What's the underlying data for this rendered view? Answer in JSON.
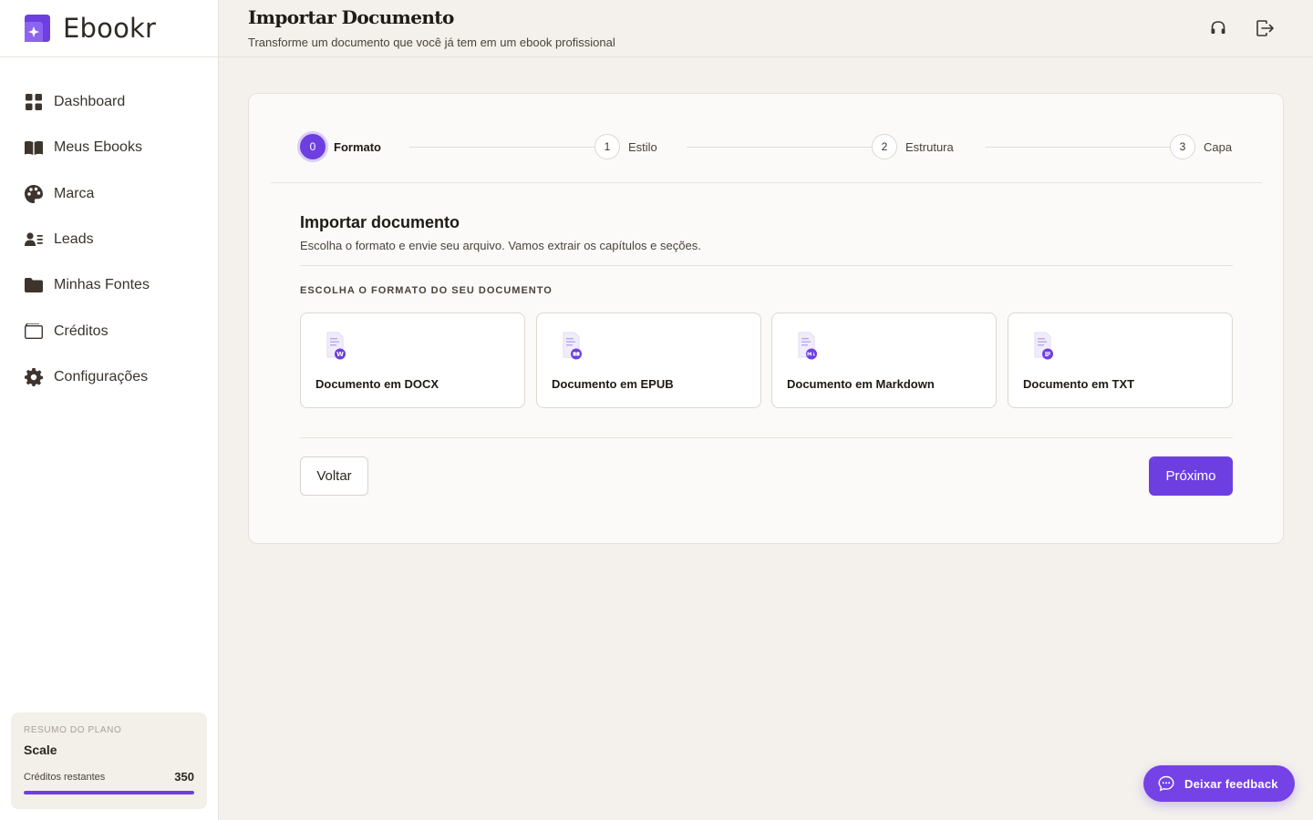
{
  "brand": {
    "name": "Ebookr",
    "accent": "#6d3fe0"
  },
  "sidebar": {
    "items": [
      {
        "label": "Dashboard",
        "icon": "dashboard-icon"
      },
      {
        "label": "Meus Ebooks",
        "icon": "book-icon"
      },
      {
        "label": "Marca",
        "icon": "palette-icon"
      },
      {
        "label": "Leads",
        "icon": "contacts-icon"
      },
      {
        "label": "Minhas Fontes",
        "icon": "folder-icon"
      },
      {
        "label": "Créditos",
        "icon": "wallet-icon"
      },
      {
        "label": "Configurações",
        "icon": "gear-icon"
      }
    ],
    "plan": {
      "caption": "RESUMO DO PLANO",
      "name": "Scale",
      "credits_label": "Créditos restantes",
      "credits_value": "350",
      "credits_fraction": 1.0
    }
  },
  "header": {
    "title": "Importar Documento",
    "subtitle": "Transforme um documento que você já tem em um ebook profissional",
    "support_icon": "headset-icon",
    "logout_icon": "logout-icon"
  },
  "stepper": {
    "steps": [
      {
        "number": "0",
        "label": "Formato",
        "active": true
      },
      {
        "number": "1",
        "label": "Estilo",
        "active": false
      },
      {
        "number": "2",
        "label": "Estrutura",
        "active": false
      },
      {
        "number": "3",
        "label": "Capa",
        "active": false
      }
    ]
  },
  "main": {
    "title": "Importar documento",
    "description": "Escolha o formato e envie seu arquivo. Vamos extrair os capítulos e seções.",
    "format_caption": "ESCOLHA O FORMATO DO SEU DOCUMENTO",
    "formats": [
      {
        "label": "Documento em DOCX",
        "badge": "W",
        "icon": "docx-file-icon"
      },
      {
        "label": "Documento em EPUB",
        "badge": "📖",
        "icon": "epub-file-icon"
      },
      {
        "label": "Documento em Markdown",
        "badge": "M↓",
        "icon": "markdown-file-icon"
      },
      {
        "label": "Documento em TXT",
        "badge": "≡",
        "icon": "txt-file-icon"
      }
    ],
    "back_label": "Voltar",
    "next_label": "Próximo"
  },
  "feedback": {
    "label": "Deixar feedback",
    "icon": "chat-icon"
  }
}
